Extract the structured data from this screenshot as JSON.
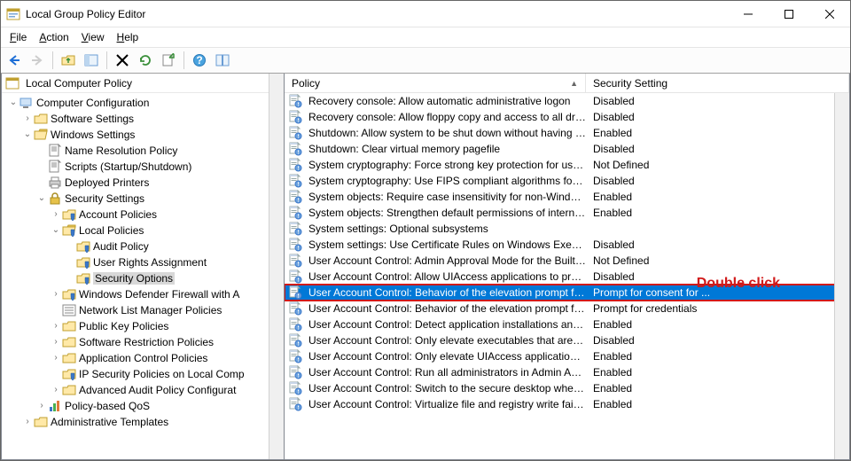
{
  "window": {
    "title": "Local Group Policy Editor"
  },
  "menu": {
    "file": "File",
    "action": "Action",
    "view": "View",
    "help": "Help"
  },
  "tree": {
    "root": "Local Computer Policy",
    "cc": "Computer Configuration",
    "ss": "Software Settings",
    "ws": "Windows Settings",
    "nrp": "Name Resolution Policy",
    "scripts": "Scripts (Startup/Shutdown)",
    "dp": "Deployed Printers",
    "sec": "Security Settings",
    "ap": "Account Policies",
    "lp": "Local Policies",
    "audit": "Audit Policy",
    "ura": "User Rights Assignment",
    "so": "Security Options",
    "wdfw": "Windows Defender Firewall with A",
    "nlmp": "Network List Manager Policies",
    "pkp": "Public Key Policies",
    "srp": "Software Restriction Policies",
    "acp": "Application Control Policies",
    "ipsec": "IP Security Policies on Local Comp",
    "aapc": "Advanced Audit Policy Configurat",
    "pbq": "Policy-based QoS",
    "at": "Administrative Templates"
  },
  "cols": {
    "policy": "Policy",
    "setting": "Security Setting"
  },
  "rows": [
    {
      "name": "Recovery console: Allow automatic administrative logon",
      "setting": "Disabled"
    },
    {
      "name": "Recovery console: Allow floppy copy and access to all drives...",
      "setting": "Disabled"
    },
    {
      "name": "Shutdown: Allow system to be shut down without having to...",
      "setting": "Enabled"
    },
    {
      "name": "Shutdown: Clear virtual memory pagefile",
      "setting": "Disabled"
    },
    {
      "name": "System cryptography: Force strong key protection for user k...",
      "setting": "Not Defined"
    },
    {
      "name": "System cryptography: Use FIPS compliant algorithms for en...",
      "setting": "Disabled"
    },
    {
      "name": "System objects: Require case insensitivity for non-Windows ...",
      "setting": "Enabled"
    },
    {
      "name": "System objects: Strengthen default permissions of internal s...",
      "setting": "Enabled"
    },
    {
      "name": "System settings: Optional subsystems",
      "setting": ""
    },
    {
      "name": "System settings: Use Certificate Rules on Windows Executabl...",
      "setting": "Disabled"
    },
    {
      "name": "User Account Control: Admin Approval Mode for the Built-i...",
      "setting": "Not Defined"
    },
    {
      "name": "User Account Control: Allow UIAccess applications to prom...",
      "setting": "Disabled"
    },
    {
      "name": "User Account Control: Behavior of the elevation prompt for ...",
      "setting": "Prompt for consent for ...",
      "selected": true
    },
    {
      "name": "User Account Control: Behavior of the elevation prompt for ...",
      "setting": "Prompt for credentials"
    },
    {
      "name": "User Account Control: Detect application installations and p...",
      "setting": "Enabled"
    },
    {
      "name": "User Account Control: Only elevate executables that are sign...",
      "setting": "Disabled"
    },
    {
      "name": "User Account Control: Only elevate UIAccess applications th...",
      "setting": "Enabled"
    },
    {
      "name": "User Account Control: Run all administrators in Admin Appr...",
      "setting": "Enabled"
    },
    {
      "name": "User Account Control: Switch to the secure desktop when pr...",
      "setting": "Enabled"
    },
    {
      "name": "User Account Control: Virtualize file and registry write failure...",
      "setting": "Enabled"
    }
  ],
  "callout": "Double click"
}
